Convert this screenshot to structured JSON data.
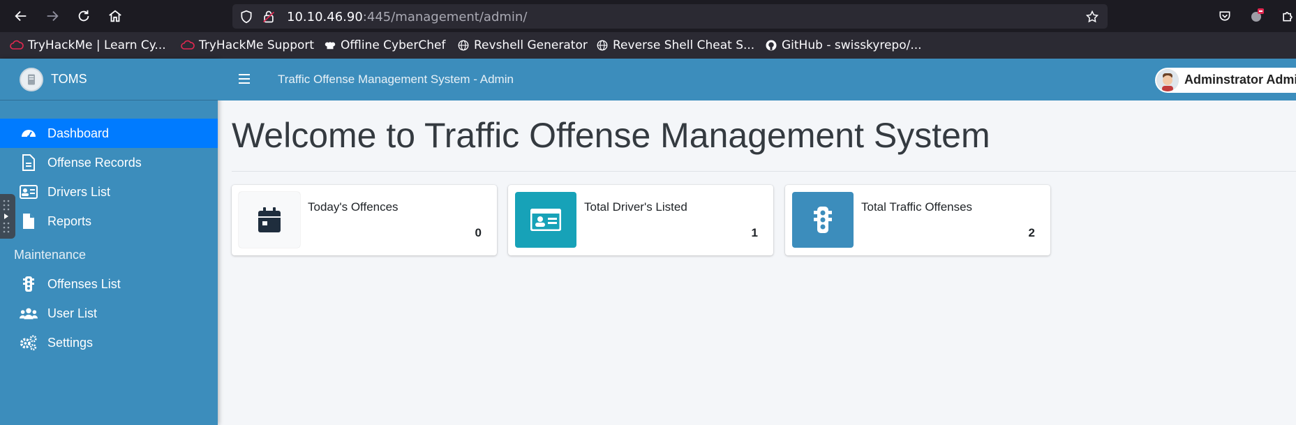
{
  "browser": {
    "url_host": "10.10.46.90",
    "url_rest": ":445/management/admin/",
    "bookmarks": [
      {
        "label": "TryHackMe | Learn Cy...",
        "icon": "tryhackme-icon"
      },
      {
        "label": "TryHackMe Support",
        "icon": "tryhackme-icon"
      },
      {
        "label": "Offline CyberChef",
        "icon": "chef-hat-icon"
      },
      {
        "label": "Revshell Generator",
        "icon": "globe-icon"
      },
      {
        "label": "Reverse Shell Cheat S...",
        "icon": "globe-icon"
      },
      {
        "label": "GitHub - swisskyrepo/...",
        "icon": "github-icon"
      }
    ]
  },
  "sidebar": {
    "brand": "TOMS",
    "items": [
      {
        "label": "Dashboard",
        "icon": "dashboard-gauge-icon",
        "active": true
      },
      {
        "label": "Offense Records",
        "icon": "file-text-icon",
        "active": false
      },
      {
        "label": "Drivers List",
        "icon": "id-card-icon",
        "active": false
      },
      {
        "label": "Reports",
        "icon": "file-icon",
        "active": false
      }
    ],
    "maintenance_header": "Maintenance",
    "maintenance_items": [
      {
        "label": "Offenses List",
        "icon": "traffic-light-icon"
      },
      {
        "label": "User List",
        "icon": "users-icon"
      },
      {
        "label": "Settings",
        "icon": "cogs-icon"
      }
    ]
  },
  "topbar": {
    "title": "Traffic Offense Management System - Admin",
    "user_name": "Adminstrator Admin"
  },
  "main": {
    "welcome": "Welcome to Traffic Offense Management System",
    "cards": [
      {
        "title": "Today's Offences",
        "value": "0",
        "icon": "calendar-icon",
        "color": "#f8f9fa"
      },
      {
        "title": "Total Driver's Listed",
        "value": "1",
        "icon": "id-card-icon",
        "color": "#17a2b8"
      },
      {
        "title": "Total Traffic Offenses",
        "value": "2",
        "icon": "traffic-light-icon",
        "color": "#3c8dbc"
      }
    ]
  },
  "colors": {
    "sidebar": "#3c8dbc",
    "active": "#007bff",
    "browser_toolbar": "#1c1b22"
  }
}
